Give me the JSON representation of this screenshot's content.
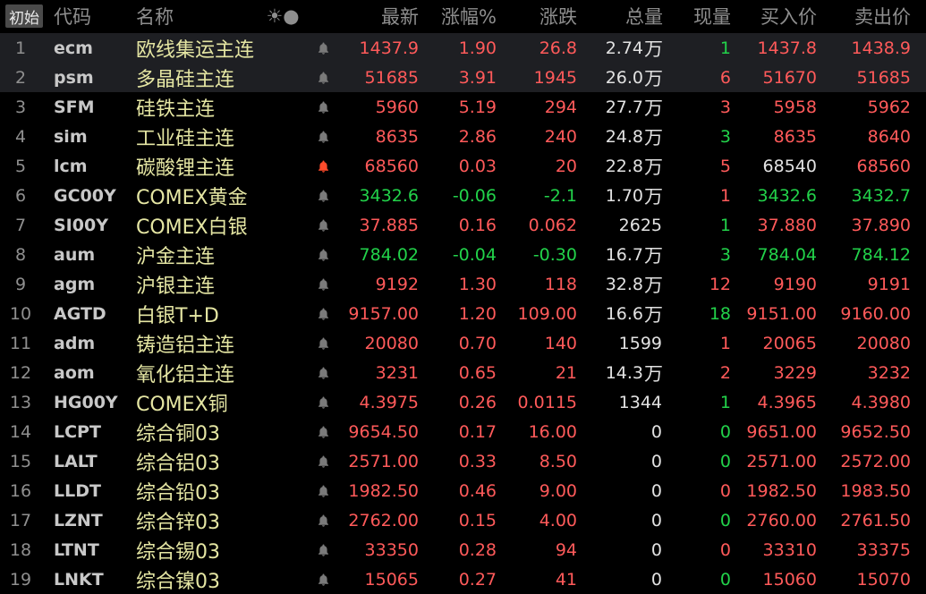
{
  "header": {
    "start_label": "初始",
    "columns": {
      "code": "代码",
      "name": "名称",
      "icons": "☀●",
      "last": "最新",
      "pct": "涨幅%",
      "change": "涨跌",
      "total_volume": "总量",
      "current_volume": "现量",
      "bid": "买入价",
      "ask": "卖出价"
    }
  },
  "colors": {
    "up": "#ff5a5a",
    "down": "#22d24a",
    "neutral": "#e2e2e2",
    "name": "#e5e6a3",
    "bell_active": "#ff4b2b"
  },
  "rows": [
    {
      "idx": "1",
      "code": "ecm",
      "name": "欧线集运主连",
      "bell": "off",
      "last": "1437.9",
      "last_dir": "up",
      "pct": "1.90",
      "pct_dir": "up",
      "chg": "26.8",
      "chg_dir": "up",
      "vol": "2.74",
      "vol_unit": "万",
      "cur": "1",
      "cur_dir": "down",
      "bid": "1437.8",
      "bid_dir": "up",
      "ask": "1438.9",
      "ask_dir": "up",
      "selected": true
    },
    {
      "idx": "2",
      "code": "psm",
      "name": "多晶硅主连",
      "bell": "off",
      "last": "51685",
      "last_dir": "up",
      "pct": "3.91",
      "pct_dir": "up",
      "chg": "1945",
      "chg_dir": "up",
      "vol": "26.0",
      "vol_unit": "万",
      "cur": "6",
      "cur_dir": "up",
      "bid": "51670",
      "bid_dir": "up",
      "ask": "51685",
      "ask_dir": "up",
      "selected": true
    },
    {
      "idx": "3",
      "code": "SFM",
      "name": "硅铁主连",
      "bell": "off",
      "last": "5960",
      "last_dir": "up",
      "pct": "5.19",
      "pct_dir": "up",
      "chg": "294",
      "chg_dir": "up",
      "vol": "27.7",
      "vol_unit": "万",
      "cur": "3",
      "cur_dir": "up",
      "bid": "5958",
      "bid_dir": "up",
      "ask": "5962",
      "ask_dir": "up"
    },
    {
      "idx": "4",
      "code": "sim",
      "name": "工业硅主连",
      "bell": "off",
      "last": "8635",
      "last_dir": "up",
      "pct": "2.86",
      "pct_dir": "up",
      "chg": "240",
      "chg_dir": "up",
      "vol": "24.8",
      "vol_unit": "万",
      "cur": "3",
      "cur_dir": "down",
      "bid": "8635",
      "bid_dir": "up",
      "ask": "8640",
      "ask_dir": "up"
    },
    {
      "idx": "5",
      "code": "lcm",
      "name": "碳酸锂主连",
      "bell": "on",
      "last": "68560",
      "last_dir": "up",
      "pct": "0.03",
      "pct_dir": "up",
      "chg": "20",
      "chg_dir": "up",
      "vol": "22.8",
      "vol_unit": "万",
      "cur": "5",
      "cur_dir": "up",
      "bid": "68540",
      "bid_dir": "neutral",
      "ask": "68560",
      "ask_dir": "up"
    },
    {
      "idx": "6",
      "code": "GC00Y",
      "name": "COMEX黄金",
      "bell": "off",
      "last": "3432.6",
      "last_dir": "down",
      "pct": "-0.06",
      "pct_dir": "down",
      "chg": "-2.1",
      "chg_dir": "down",
      "vol": "1.70",
      "vol_unit": "万",
      "cur": "1",
      "cur_dir": "up",
      "bid": "3432.6",
      "bid_dir": "down",
      "ask": "3432.7",
      "ask_dir": "down"
    },
    {
      "idx": "7",
      "code": "SI00Y",
      "name": "COMEX白银",
      "bell": "off",
      "last": "37.885",
      "last_dir": "up",
      "pct": "0.16",
      "pct_dir": "up",
      "chg": "0.062",
      "chg_dir": "up",
      "vol": "2625",
      "vol_unit": "",
      "cur": "1",
      "cur_dir": "down",
      "bid": "37.880",
      "bid_dir": "up",
      "ask": "37.890",
      "ask_dir": "up"
    },
    {
      "idx": "8",
      "code": "aum",
      "name": "沪金主连",
      "bell": "off",
      "last": "784.02",
      "last_dir": "down",
      "pct": "-0.04",
      "pct_dir": "down",
      "chg": "-0.30",
      "chg_dir": "down",
      "vol": "16.7",
      "vol_unit": "万",
      "cur": "3",
      "cur_dir": "down",
      "bid": "784.04",
      "bid_dir": "down",
      "ask": "784.12",
      "ask_dir": "down"
    },
    {
      "idx": "9",
      "code": "agm",
      "name": "沪银主连",
      "bell": "off",
      "last": "9192",
      "last_dir": "up",
      "pct": "1.30",
      "pct_dir": "up",
      "chg": "118",
      "chg_dir": "up",
      "vol": "32.8",
      "vol_unit": "万",
      "cur": "12",
      "cur_dir": "up",
      "bid": "9190",
      "bid_dir": "up",
      "ask": "9191",
      "ask_dir": "up"
    },
    {
      "idx": "10",
      "code": "AGTD",
      "name": "白银T+D",
      "bell": "off",
      "last": "9157.00",
      "last_dir": "up",
      "pct": "1.20",
      "pct_dir": "up",
      "chg": "109.00",
      "chg_dir": "up",
      "vol": "16.6",
      "vol_unit": "万",
      "cur": "18",
      "cur_dir": "down",
      "bid": "9151.00",
      "bid_dir": "up",
      "ask": "9160.00",
      "ask_dir": "up"
    },
    {
      "idx": "11",
      "code": "adm",
      "name": "铸造铝主连",
      "bell": "off",
      "last": "20080",
      "last_dir": "up",
      "pct": "0.70",
      "pct_dir": "up",
      "chg": "140",
      "chg_dir": "up",
      "vol": "1599",
      "vol_unit": "",
      "cur": "1",
      "cur_dir": "up",
      "bid": "20065",
      "bid_dir": "up",
      "ask": "20080",
      "ask_dir": "up"
    },
    {
      "idx": "12",
      "code": "aom",
      "name": "氧化铝主连",
      "bell": "off",
      "last": "3231",
      "last_dir": "up",
      "pct": "0.65",
      "pct_dir": "up",
      "chg": "21",
      "chg_dir": "up",
      "vol": "14.3",
      "vol_unit": "万",
      "cur": "2",
      "cur_dir": "up",
      "bid": "3229",
      "bid_dir": "up",
      "ask": "3232",
      "ask_dir": "up"
    },
    {
      "idx": "13",
      "code": "HG00Y",
      "name": "COMEX铜",
      "bell": "off",
      "last": "4.3975",
      "last_dir": "up",
      "pct": "0.26",
      "pct_dir": "up",
      "chg": "0.0115",
      "chg_dir": "up",
      "vol": "1344",
      "vol_unit": "",
      "cur": "1",
      "cur_dir": "down",
      "bid": "4.3965",
      "bid_dir": "up",
      "ask": "4.3980",
      "ask_dir": "up"
    },
    {
      "idx": "14",
      "code": "LCPT",
      "name": "综合铜03",
      "bell": "off",
      "last": "9654.50",
      "last_dir": "up",
      "pct": "0.17",
      "pct_dir": "up",
      "chg": "16.00",
      "chg_dir": "up",
      "vol": "0",
      "vol_unit": "",
      "cur": "0",
      "cur_dir": "down",
      "bid": "9651.00",
      "bid_dir": "up",
      "ask": "9652.50",
      "ask_dir": "up"
    },
    {
      "idx": "15",
      "code": "LALT",
      "name": "综合铝03",
      "bell": "off",
      "last": "2571.00",
      "last_dir": "up",
      "pct": "0.33",
      "pct_dir": "up",
      "chg": "8.50",
      "chg_dir": "up",
      "vol": "0",
      "vol_unit": "",
      "cur": "0",
      "cur_dir": "down",
      "bid": "2571.00",
      "bid_dir": "up",
      "ask": "2572.00",
      "ask_dir": "up"
    },
    {
      "idx": "16",
      "code": "LLDT",
      "name": "综合铅03",
      "bell": "off",
      "last": "1982.50",
      "last_dir": "up",
      "pct": "0.46",
      "pct_dir": "up",
      "chg": "9.00",
      "chg_dir": "up",
      "vol": "0",
      "vol_unit": "",
      "cur": "0",
      "cur_dir": "up",
      "bid": "1982.50",
      "bid_dir": "up",
      "ask": "1983.50",
      "ask_dir": "up"
    },
    {
      "idx": "17",
      "code": "LZNT",
      "name": "综合锌03",
      "bell": "off",
      "last": "2762.00",
      "last_dir": "up",
      "pct": "0.15",
      "pct_dir": "up",
      "chg": "4.00",
      "chg_dir": "up",
      "vol": "0",
      "vol_unit": "",
      "cur": "0",
      "cur_dir": "down",
      "bid": "2760.00",
      "bid_dir": "up",
      "ask": "2761.50",
      "ask_dir": "up"
    },
    {
      "idx": "18",
      "code": "LTNT",
      "name": "综合锡03",
      "bell": "off",
      "last": "33350",
      "last_dir": "up",
      "pct": "0.28",
      "pct_dir": "up",
      "chg": "94",
      "chg_dir": "up",
      "vol": "0",
      "vol_unit": "",
      "cur": "0",
      "cur_dir": "up",
      "bid": "33310",
      "bid_dir": "up",
      "ask": "33375",
      "ask_dir": "up"
    },
    {
      "idx": "19",
      "code": "LNKT",
      "name": "综合镍03",
      "bell": "off",
      "last": "15065",
      "last_dir": "up",
      "pct": "0.27",
      "pct_dir": "up",
      "chg": "41",
      "chg_dir": "up",
      "vol": "0",
      "vol_unit": "",
      "cur": "0",
      "cur_dir": "down",
      "bid": "15060",
      "bid_dir": "up",
      "ask": "15070",
      "ask_dir": "up"
    }
  ]
}
